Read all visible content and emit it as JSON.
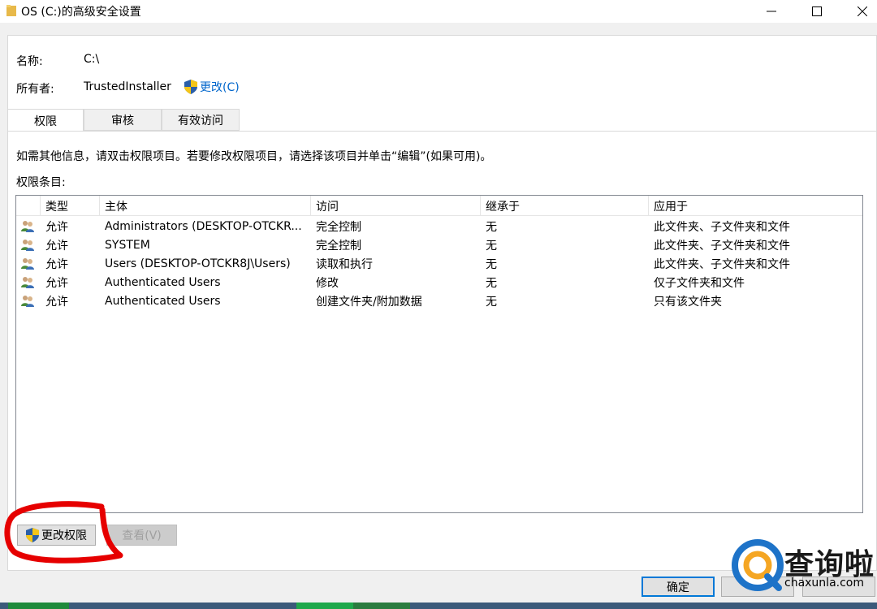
{
  "window": {
    "title": "OS (C:)的高级安全设置",
    "min_glyph": "—",
    "max_glyph": "☐",
    "close_glyph": "✕"
  },
  "properties": {
    "name_label": "名称:",
    "name_value": "C:\\",
    "owner_label": "所有者:",
    "owner_value": "TrustedInstaller",
    "change_owner_label": "更改(C)"
  },
  "tabs": [
    {
      "label": "权限",
      "active": true
    },
    {
      "label": "审核",
      "active": false
    },
    {
      "label": "有效访问",
      "active": false
    }
  ],
  "info_text": "如需其他信息，请双击权限项目。若要修改权限项目，请选择该项目并单击“编辑”(如果可用)。",
  "entries_label": "权限条目:",
  "table": {
    "columns": [
      "类型",
      "主体",
      "访问",
      "继承于",
      "应用于"
    ],
    "rows": [
      {
        "type": "允许",
        "principal": "Administrators (DESKTOP-OTCKR...",
        "access": "完全控制",
        "inherited": "无",
        "applies": "此文件夹、子文件夹和文件"
      },
      {
        "type": "允许",
        "principal": "SYSTEM",
        "access": "完全控制",
        "inherited": "无",
        "applies": "此文件夹、子文件夹和文件"
      },
      {
        "type": "允许",
        "principal": "Users (DESKTOP-OTCKR8J\\Users)",
        "access": "读取和执行",
        "inherited": "无",
        "applies": "此文件夹、子文件夹和文件"
      },
      {
        "type": "允许",
        "principal": "Authenticated Users",
        "access": "修改",
        "inherited": "无",
        "applies": "仅子文件夹和文件"
      },
      {
        "type": "允许",
        "principal": "Authenticated Users",
        "access": "创建文件夹/附加数据",
        "inherited": "无",
        "applies": "只有该文件夹"
      }
    ]
  },
  "buttons": {
    "change_permissions": "更改权限",
    "view": "查看(V)",
    "ok": "确定",
    "cancel": "",
    "apply": ""
  },
  "watermark": {
    "brand": "查询啦",
    "url": "chaxunla.com"
  },
  "colors": {
    "accent": "#0078d7",
    "link": "#0066cc",
    "annotation": "#e60000"
  }
}
